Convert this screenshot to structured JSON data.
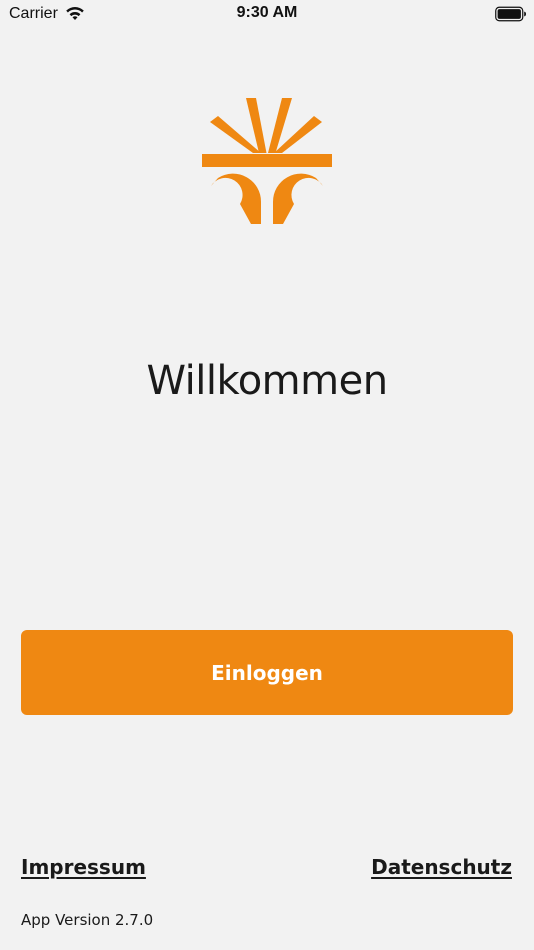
{
  "status_bar": {
    "carrier": "Carrier",
    "time": "9:30 AM"
  },
  "brand": {
    "logo_icon": "orange-sunburst-icon",
    "accent_color": "#ef8812"
  },
  "welcome": {
    "title": "Willkommen"
  },
  "login": {
    "label": "Einloggen"
  },
  "footer": {
    "impressum": "Impressum",
    "datenschutz": "Datenschutz",
    "app_version": "App Version 2.7.0"
  }
}
